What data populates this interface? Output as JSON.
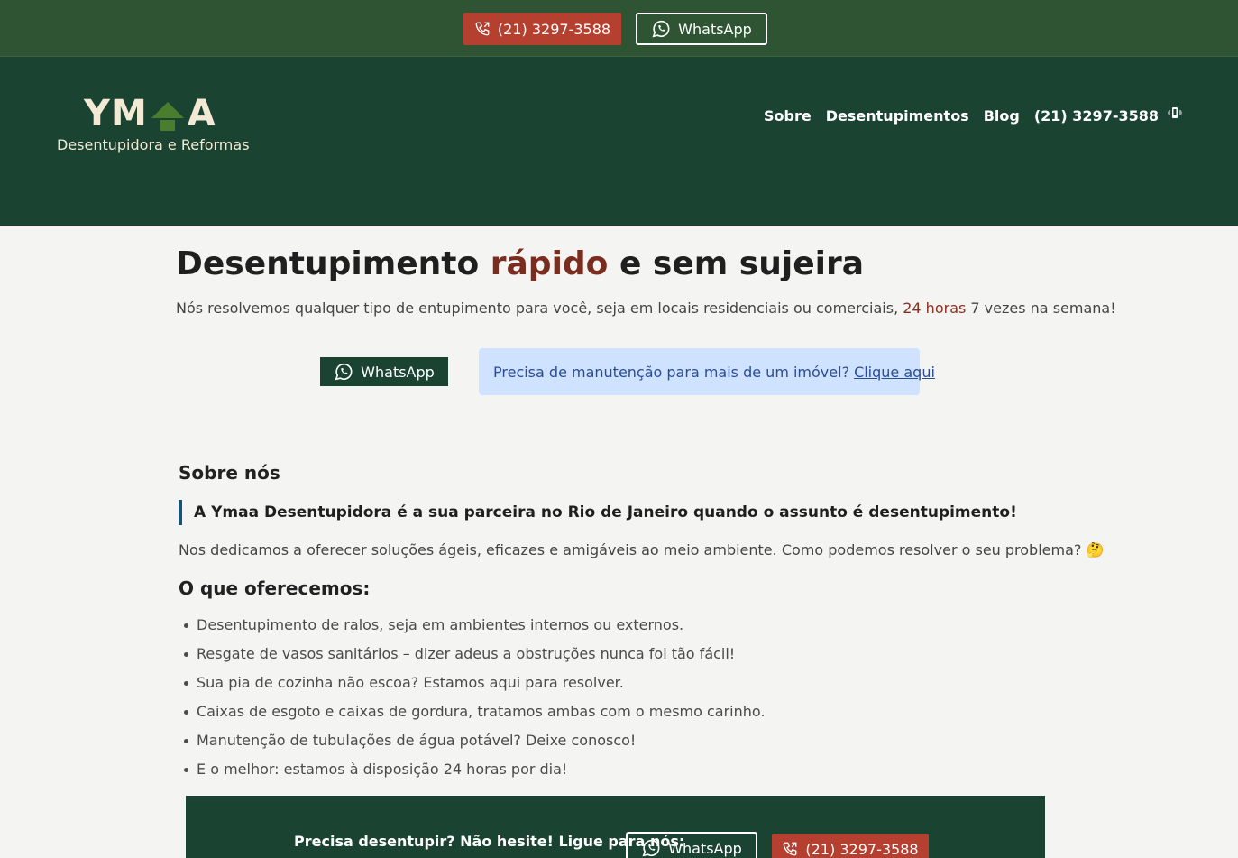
{
  "topbar": {
    "phone_label": "(21) 3297-3588",
    "whatsapp_label": "WhatsApp"
  },
  "header": {
    "logo_text_left": "YM",
    "logo_text_right": "A",
    "logo_subtitle": "Desentupidora e Reformas",
    "nav": {
      "about": "Sobre",
      "services": "Desentupimentos",
      "blog": "Blog",
      "phone": "(21) 3297-3588"
    }
  },
  "hero": {
    "title_part1": "Desentupimento ",
    "title_accent": "rápido",
    "title_part2": " e sem sujeira",
    "subtitle_part1": "Nós resolvemos qualquer tipo de entupimento para você, seja em locais residenciais ou comerciais, ",
    "subtitle_accent": "24 horas",
    "subtitle_part2": " 7 vezes na semana!",
    "whatsapp_label": "WhatsApp",
    "notice_text": "Precisa de manutenção para mais de um imóvel?",
    "notice_link": "Clique aqui"
  },
  "about": {
    "heading": "Sobre nós",
    "quote": "A Ymaa Desentupidora é a sua parceira no Rio de Janeiro quando o assunto é desentupimento!",
    "paragraph": "Nos dedicamos a oferecer soluções ágeis, eficazes e amigáveis ao meio ambiente. Como podemos resolver o seu problema? 🤔"
  },
  "offer": {
    "heading": "O que oferecemos:",
    "items": [
      "Desentupimento de ralos, seja em ambientes internos ou externos.",
      "Resgate de vasos sanitários – dizer adeus a obstruções nunca foi tão fácil!",
      "Sua pia de cozinha não escoa? Estamos aqui para resolver.",
      "Caixas de esgoto e caixas de gordura, tratamos ambas com o mesmo carinho.",
      "Manutenção de tubulações de água potável? Deixe conosco!",
      "E o melhor: estamos à disposição 24 horas por dia!"
    ]
  },
  "cta": {
    "text": "Precisa desentupir? Não hesite! Ligue para nós:",
    "whatsapp_label": "WhatsApp",
    "phone_label": "(21) 3297-3588"
  },
  "colors": {
    "topbar_bg": "#2e5433",
    "header_bg": "#1b4332",
    "phone_button": "#b5402f",
    "accent_text": "#7a2c1f",
    "notice_bg": "#cfe2ff"
  }
}
